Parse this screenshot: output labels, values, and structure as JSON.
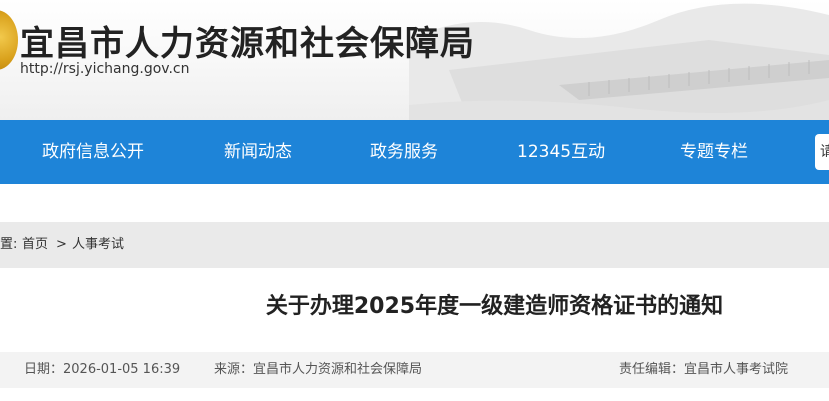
{
  "header": {
    "title": "宜昌市人力资源和社会保障局",
    "url": "http://rsj.yichang.gov.cn"
  },
  "nav": {
    "items": [
      "政府信息公开",
      "新闻动态",
      "政务服务",
      "12345互动",
      "专题专栏"
    ],
    "search_placeholder": "请"
  },
  "breadcrumb": {
    "prefix": "置:",
    "home": "首页",
    "separator": ">",
    "current": "人事考试"
  },
  "article": {
    "title": "关于办理2025年度一级建造师资格证书的通知",
    "date": "日期：2026-01-05 16:39",
    "source": "来源：宜昌市人力资源和社会保障局",
    "editor": "责任编辑：宜昌市人事考试院"
  },
  "colors": {
    "nav_bg": "#1e84d8",
    "breadcrumb_bg": "#eaeaea",
    "meta_bg": "#f3f3f3"
  }
}
